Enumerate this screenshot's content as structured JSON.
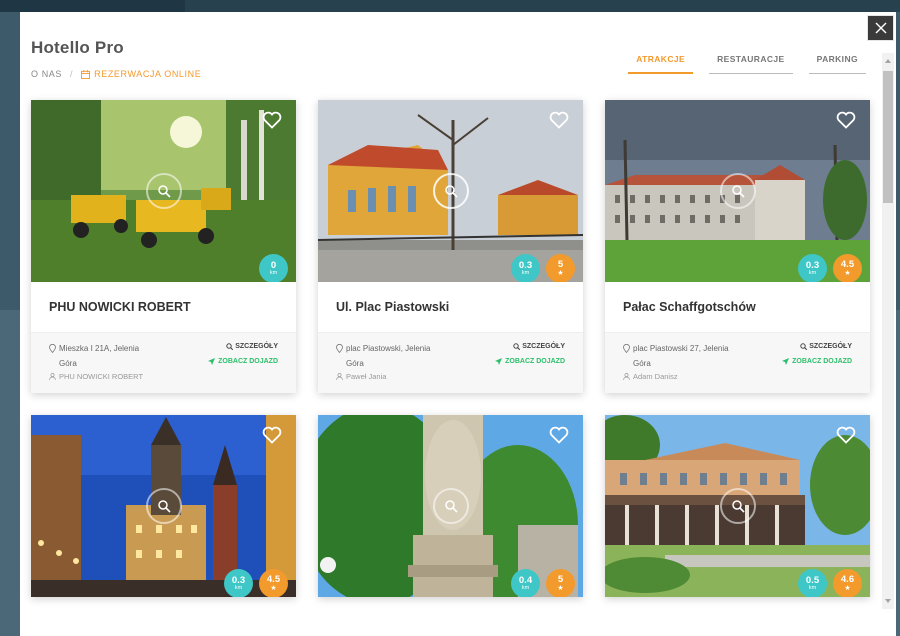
{
  "app": {
    "title": "Hotello Pro",
    "breadcrumb": {
      "about": "O NAS",
      "separator": "/",
      "booking": "REZERWACJA ONLINE"
    }
  },
  "tabs": [
    {
      "label": "ATRAKCJE",
      "active": true
    },
    {
      "label": "RESTAURACJE",
      "active": false
    },
    {
      "label": "PARKING",
      "active": false
    }
  ],
  "cards": [
    {
      "name": "PHU NOWICKI ROBERT",
      "address": "Mieszka I 21A, Jelenia Góra",
      "owner": "PHU NOWICKI ROBERT",
      "distance": "0",
      "distance_unit": "km",
      "rating": "",
      "details": "SZCZEGÓŁY",
      "directions": "ZOBACZ DOJAZD"
    },
    {
      "name": "Ul. Plac Piastowski",
      "address": "plac Piastowski, Jelenia Góra",
      "owner": "Paweł Jania",
      "distance": "0.3",
      "distance_unit": "km",
      "rating": "5",
      "details": "SZCZEGÓŁY",
      "directions": "ZOBACZ DOJAZD"
    },
    {
      "name": "Pałac Schaffgotschów",
      "address": "plac Piastowski 27, Jelenia Góra",
      "owner": "Adam Danisz",
      "distance": "0.3",
      "distance_unit": "km",
      "rating": "4.5",
      "details": "SZCZEGÓŁY",
      "directions": "ZOBACZ DOJAZD"
    },
    {
      "distance": "0.3",
      "distance_unit": "km",
      "rating": "4.5"
    },
    {
      "distance": "0.4",
      "distance_unit": "km",
      "rating": "5"
    },
    {
      "distance": "0.5",
      "distance_unit": "km",
      "rating": "4.6"
    }
  ],
  "colors": {
    "accent": "#f39a2d",
    "distance_badge": "#3ec7c6",
    "directions": "#2cbf6b",
    "close_button": "#3a3a3a"
  },
  "icons": {
    "close": "close-icon",
    "calendar": "calendar-icon",
    "heart": "heart-icon",
    "zoom": "magnifier-icon",
    "location": "map-pin-icon",
    "user": "user-icon",
    "search": "search-icon",
    "navigate": "navigation-arrow-icon",
    "star": "star-icon"
  }
}
